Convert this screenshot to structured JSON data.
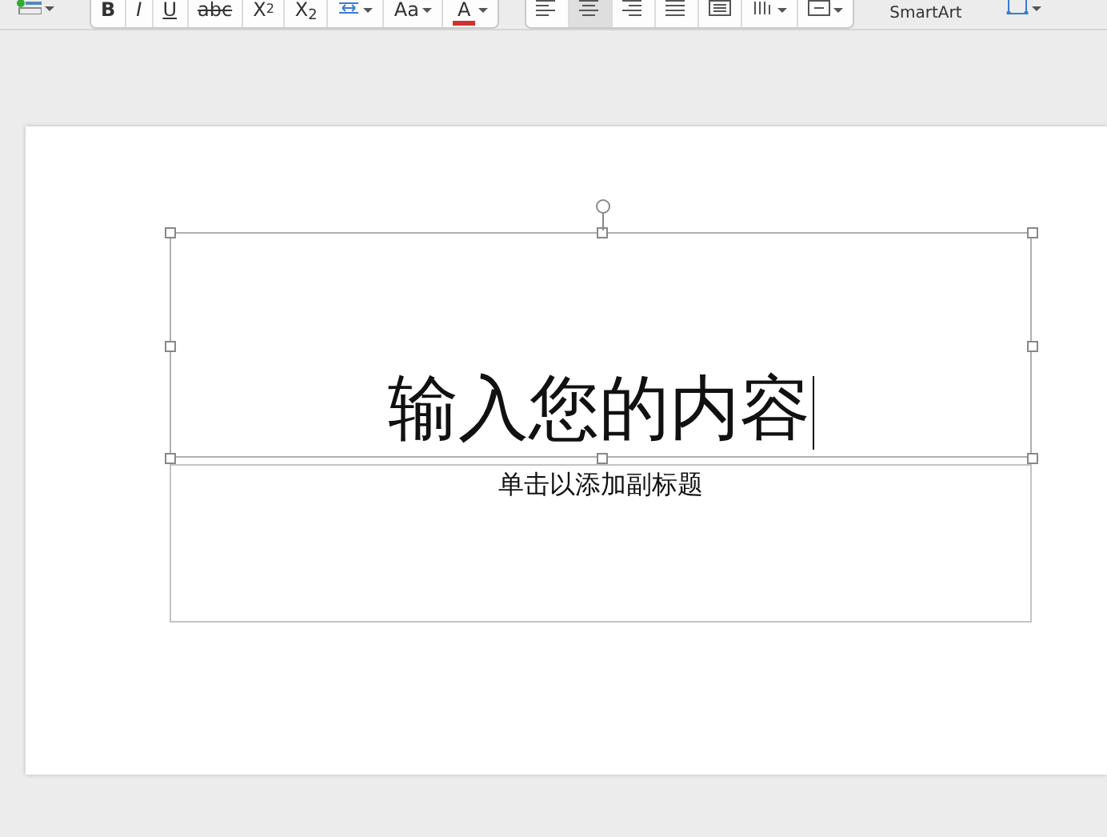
{
  "toolbar": {
    "groups": [
      {
        "framed": false,
        "items": [
          {
            "kind": "bullets",
            "dropdown": true,
            "selected": false
          }
        ]
      },
      {
        "framed": true,
        "items": [
          {
            "kind": "bold",
            "label": "B",
            "dropdown": false,
            "selected": false
          },
          {
            "kind": "italic",
            "label": "I",
            "dropdown": false,
            "selected": false
          },
          {
            "kind": "underline",
            "label": "U",
            "dropdown": false,
            "selected": false
          },
          {
            "kind": "strike",
            "label": "abc",
            "dropdown": false,
            "selected": false
          },
          {
            "kind": "script",
            "label": "X$^{2}$",
            "dropdown": false,
            "selected": false
          },
          {
            "kind": "script",
            "label": "X$_{2}$",
            "dropdown": false,
            "selected": false
          },
          {
            "kind": "spacing",
            "dropdown": true,
            "selected": false
          },
          {
            "kind": "case",
            "label": "Aa",
            "dropdown": true,
            "selected": false
          },
          {
            "kind": "font-color",
            "label": "A",
            "dropdown": true,
            "selected": false
          }
        ]
      },
      {
        "framed": true,
        "items": [
          {
            "kind": "align-left",
            "dropdown": false,
            "selected": false
          },
          {
            "kind": "align-center",
            "dropdown": false,
            "selected": true
          },
          {
            "kind": "align-right",
            "dropdown": false,
            "selected": false
          },
          {
            "kind": "justify",
            "dropdown": false,
            "selected": false
          },
          {
            "kind": "columns",
            "dropdown": false,
            "selected": false
          },
          {
            "kind": "text-direction",
            "dropdown": true,
            "selected": false
          },
          {
            "kind": "text-align",
            "dropdown": true,
            "selected": false
          }
        ]
      },
      {
        "framed": false,
        "items": [
          {
            "kind": "smartart",
            "label": "SmartArt",
            "dropdown": false,
            "selected": false
          }
        ]
      },
      {
        "framed": false,
        "items": [
          {
            "kind": "picture",
            "dropdown": true,
            "selected": false
          }
        ]
      }
    ]
  },
  "slide": {
    "title": {
      "text": "输入您的内容",
      "selected": true
    },
    "subtitle": {
      "text": "单击以添加副标题",
      "selected": false
    }
  }
}
